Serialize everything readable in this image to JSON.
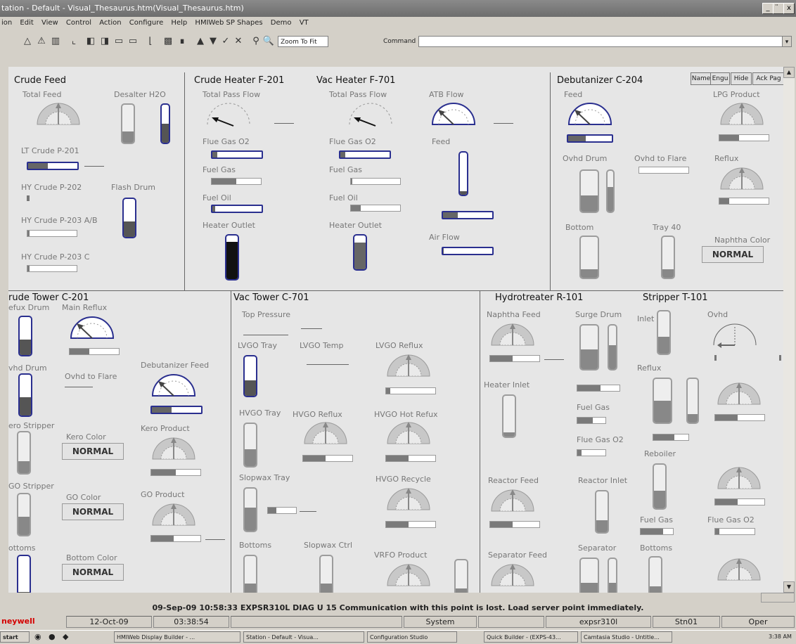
{
  "window": {
    "title": "tation - Default - Visual_Thesaurus.htm(Visual_Thesaurus.htm)",
    "min": "_",
    "restore": "̈",
    "close": "x"
  },
  "menu": [
    "ion",
    "Edit",
    "View",
    "Control",
    "Action",
    "Configure",
    "Help",
    "HMIWeb SP Shapes",
    "Demo",
    "VT"
  ],
  "toolbar": {
    "zoom_label": "Zoom To Fit",
    "command_label": "Command",
    "command_value": ""
  },
  "overlay_buttons": [
    "Name",
    "Engu",
    "Hide",
    "Ack Pag"
  ],
  "sections": {
    "crude_feed": "Crude Feed",
    "crude_heater": "Crude Heater F-201",
    "vac_heater": "Vac Heater F-701",
    "debutanizer": "Debutanizer C-204",
    "crude_tower": "rude Tower C-201",
    "vac_tower": "Vac Tower C-701",
    "hydrotreater": "Hydrotreater R-101",
    "stripper": "Stripper T-101"
  },
  "labels": {
    "total_feed": "Total Feed",
    "desalter_h2o": "Desalter H2O",
    "lt_crude": "LT Crude P-201",
    "hy_crude_202": "HY Crude P-202",
    "flash_drum": "Flash Drum",
    "hy_crude_203ab": "HY Crude P-203 A/B",
    "hy_crude_203c": "HY Crude P-203 C",
    "ch_total_pass": "Total Pass Flow",
    "ch_flue_gas": "Flue Gas O2",
    "ch_fuel_gas": "Fuel Gas",
    "ch_fuel_oil": "Fuel Oil",
    "ch_heater_outlet": "Heater Outlet",
    "vh_total_pass": "Total Pass Flow",
    "vh_atb_flow": "ATB Flow",
    "vh_flue_gas": "Flue Gas O2",
    "vh_feed": "Feed",
    "vh_fuel_gas": "Fuel Gas",
    "vh_fuel_oil": "Fuel Oil",
    "vh_heater_outlet": "Heater Outlet",
    "vh_air_flow": "Air Flow",
    "db_feed": "Feed",
    "db_lpg": "LPG Product",
    "db_ovhd_drum": "Ovhd Drum",
    "db_ovhd_flare": "Ovhd to Flare",
    "db_reflux": "Reflux",
    "db_bottom": "Bottom",
    "db_tray40": "Tray 40",
    "db_naphtha_color": "Naphtha Color",
    "ct_reflux_drum": "efux Drum",
    "ct_main_reflux": "Main Reflux",
    "ct_ovhd_drum": "vhd Drum",
    "ct_ovhd_flare": "Ovhd to Flare",
    "ct_deb_feed": "Debutanizer Feed",
    "ct_kero_stripper": "ero Stripper",
    "ct_kero_color": "Kero Color",
    "ct_kero_product": "Kero Product",
    "ct_go_stripper": "GO Stripper",
    "ct_go_color": "GO Color",
    "ct_go_product": "GO Product",
    "ct_bottoms": "ottoms",
    "ct_bottom_color": "Bottom Color",
    "vt_top_pressure": "Top Pressure",
    "vt_lvgo_tray": "LVGO Tray",
    "vt_lvgo_temp": "LVGO Temp",
    "vt_lvgo_reflux": "LVGO Reflux",
    "vt_hvgo_tray": "HVGO Tray",
    "vt_hvgo_reflux": "HVGO Reflux",
    "vt_hvgo_hot_reflux": "HVGO Hot Refux",
    "vt_slopwax_tray": "Slopwax Tray",
    "vt_hvgo_recycle": "HVGO Recycle",
    "vt_bottoms": "Bottoms",
    "vt_slopwax_ctrl": "Slopwax Ctrl",
    "vt_vrfo_product": "VRFO Product",
    "ht_naphtha_feed": "Naphtha Feed",
    "ht_surge_drum": "Surge Drum",
    "ht_heater_inlet": "Heater Inlet",
    "ht_fuel_gas": "Fuel Gas",
    "ht_flue_gas": "Flue Gas O2",
    "ht_reactor_feed": "Reactor Feed",
    "ht_reactor_inlet": "Reactor Inlet",
    "ht_separator_feed": "Separator Feed",
    "ht_separator": "Separator",
    "st_inlet": "Inlet",
    "st_ovhd": "Ovhd",
    "st_reflux": "Reflux",
    "st_reboiler": "Reboiler",
    "st_fuel_gas": "Fuel Gas",
    "st_flue_gas": "Flue Gas O2",
    "st_bottoms": "Bottoms"
  },
  "values": {
    "naphtha_color": "NORMAL",
    "kero_color": "NORMAL",
    "go_color": "NORMAL",
    "bottom_color": "NORMAL"
  },
  "alarm_line": "09-Sep-09  10:58:33  EXPSR310L  DIAG   U 15 Communication with this point is lost.  Load server point immediately.",
  "status": {
    "brand": "neywell",
    "date": "12-Oct-09",
    "time": "03:38:54",
    "area": "System",
    "server": "expsr310l",
    "station": "Stn01",
    "level": "Oper"
  },
  "taskbar": {
    "start": "start",
    "items": [
      "HMIWeb Display Builder - ...",
      "Station - Default - Visua...",
      "Configuration Studio",
      "Quick Builder - (EXPS-43...",
      "Camtasia Studio - Untitle..."
    ],
    "clock": "3:38 AM"
  },
  "colors": {
    "active_border": "#2a2f8f",
    "background": "#e6e6e6",
    "brand": "#d40000"
  }
}
